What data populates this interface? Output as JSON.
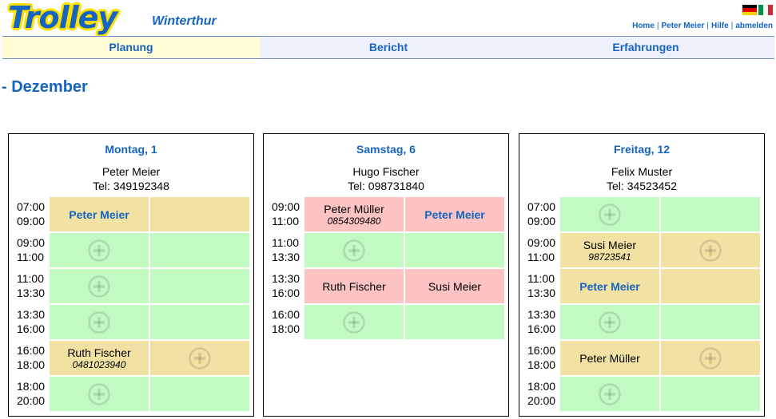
{
  "header": {
    "logo": "Trolley",
    "city": "Winterthur",
    "links": [
      "Home",
      "Peter Meier",
      "Hilfe",
      "abmelden"
    ],
    "flags": [
      "german-flag",
      "italian-flag"
    ]
  },
  "nav": {
    "tabs": [
      {
        "label": "Planung",
        "active": true
      },
      {
        "label": "Bericht",
        "active": false
      },
      {
        "label": "Erfahrungen",
        "active": false
      }
    ]
  },
  "month": "- Dezember",
  "colors": {
    "accent": "#1565c0",
    "free": "#c2fbc2",
    "booked": "#f1e1a3",
    "alert": "#fdc3c3",
    "logo_outline": "#ffe000"
  },
  "days": [
    {
      "title": "Montag, 1",
      "leader_name": "Peter Meier",
      "leader_tel": "Tel: 349192348",
      "slots": [
        {
          "start": "07:00",
          "end": "09:00",
          "color": "yellow",
          "cells": [
            {
              "type": "me",
              "name": "Peter Meier"
            },
            {
              "type": "empty"
            }
          ]
        },
        {
          "start": "09:00",
          "end": "11:00",
          "color": "green",
          "cells": [
            {
              "type": "add"
            },
            {
              "type": "empty"
            }
          ]
        },
        {
          "start": "11:00",
          "end": "13:30",
          "color": "green",
          "cells": [
            {
              "type": "add"
            },
            {
              "type": "empty"
            }
          ]
        },
        {
          "start": "13:30",
          "end": "16:00",
          "color": "green",
          "cells": [
            {
              "type": "add"
            },
            {
              "type": "empty"
            }
          ]
        },
        {
          "start": "16:00",
          "end": "18:00",
          "color": "yellow",
          "cells": [
            {
              "type": "person",
              "name": "Ruth Fischer",
              "phone": "0481023940"
            },
            {
              "type": "add"
            }
          ]
        },
        {
          "start": "18:00",
          "end": "20:00",
          "color": "green",
          "cells": [
            {
              "type": "add"
            },
            {
              "type": "empty"
            }
          ]
        }
      ]
    },
    {
      "title": "Samstag, 6",
      "leader_name": "Hugo Fischer",
      "leader_tel": "Tel: 098731840",
      "slots": [
        {
          "start": "09:00",
          "end": "11:00",
          "color": "pink",
          "cells": [
            {
              "type": "person",
              "name": "Peter Müller",
              "phone": "0854309480"
            },
            {
              "type": "me",
              "name": "Peter Meier"
            }
          ]
        },
        {
          "start": "11:00",
          "end": "13:30",
          "color": "green",
          "cells": [
            {
              "type": "add"
            },
            {
              "type": "empty"
            }
          ]
        },
        {
          "start": "13:30",
          "end": "16:00",
          "color": "pink",
          "cells": [
            {
              "type": "person",
              "name": "Ruth Fischer"
            },
            {
              "type": "person",
              "name": "Susi Meier"
            }
          ]
        },
        {
          "start": "16:00",
          "end": "18:00",
          "color": "green",
          "cells": [
            {
              "type": "add"
            },
            {
              "type": "empty"
            }
          ]
        }
      ]
    },
    {
      "title": "Freitag, 12",
      "leader_name": "Felix Muster",
      "leader_tel": "Tel: 34523452",
      "slots": [
        {
          "start": "07:00",
          "end": "09:00",
          "color": "green",
          "cells": [
            {
              "type": "add"
            },
            {
              "type": "empty"
            }
          ]
        },
        {
          "start": "09:00",
          "end": "11:00",
          "color": "yellow",
          "cells": [
            {
              "type": "person",
              "name": "Susi Meier",
              "phone": "98723541"
            },
            {
              "type": "add"
            }
          ]
        },
        {
          "start": "11:00",
          "end": "13:30",
          "color": "yellow",
          "cells": [
            {
              "type": "me",
              "name": "Peter Meier"
            },
            {
              "type": "empty"
            }
          ]
        },
        {
          "start": "13:30",
          "end": "16:00",
          "color": "green",
          "cells": [
            {
              "type": "add"
            },
            {
              "type": "empty"
            }
          ]
        },
        {
          "start": "16:00",
          "end": "18:00",
          "color": "yellow",
          "cells": [
            {
              "type": "person",
              "name": "Peter Müller"
            },
            {
              "type": "add"
            }
          ]
        },
        {
          "start": "18:00",
          "end": "20:00",
          "color": "green",
          "cells": [
            {
              "type": "add"
            },
            {
              "type": "empty"
            }
          ]
        }
      ]
    }
  ]
}
